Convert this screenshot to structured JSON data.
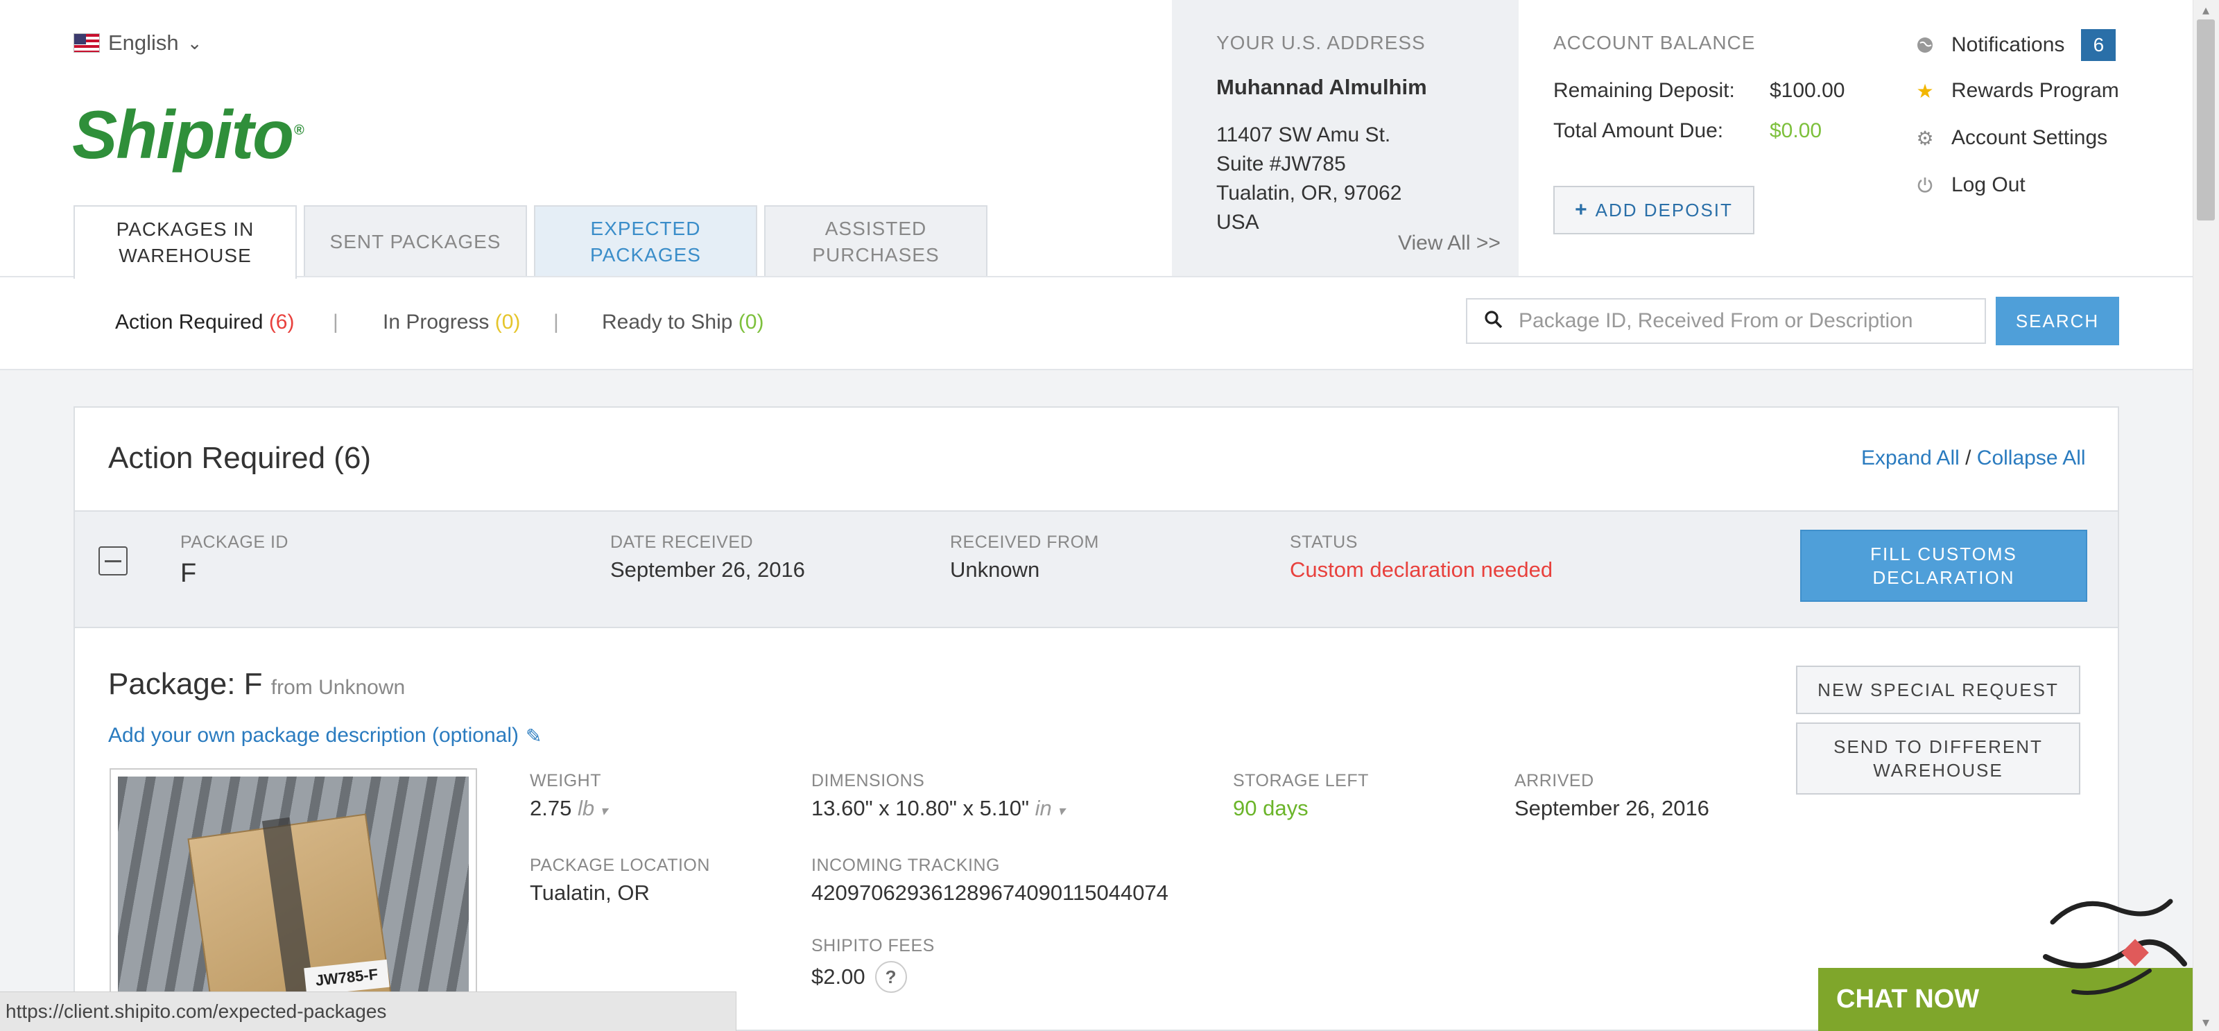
{
  "header": {
    "language": "English",
    "logo": "Shipito",
    "logo_mark": "®"
  },
  "tabs": [
    {
      "label_line1": "PACKAGES IN",
      "label_line2": "WAREHOUSE"
    },
    {
      "label_line1": "SENT PACKAGES",
      "label_line2": ""
    },
    {
      "label_line1": "EXPECTED",
      "label_line2": "PACKAGES"
    },
    {
      "label_line1": "ASSISTED",
      "label_line2": "PURCHASES"
    }
  ],
  "address": {
    "label": "YOUR U.S. ADDRESS",
    "name": "Muhannad Almulhim",
    "street": "11407 SW Amu St.",
    "suite": "Suite #JW785",
    "city": "Tualatin, OR, 97062",
    "country": "USA",
    "view_all": "View All >>"
  },
  "balance": {
    "label": "ACCOUNT BALANCE",
    "remaining_label": "Remaining Deposit:",
    "remaining_value": "$100.00",
    "due_label": "Total Amount Due:",
    "due_value": "$0.00",
    "add_deposit": "ADD DEPOSIT"
  },
  "account_menu": {
    "notifications": "Notifications",
    "notifications_count": "6",
    "rewards": "Rewards Program",
    "settings": "Account Settings",
    "logout": "Log Out"
  },
  "filters": {
    "action_required": "Action Required",
    "action_required_count": "(6)",
    "in_progress": "In Progress",
    "in_progress_count": "(0)",
    "ready_to_ship": "Ready to Ship",
    "ready_to_ship_count": "(0)",
    "separator": "|"
  },
  "search": {
    "placeholder": "Package ID, Received From or Description",
    "button": "SEARCH"
  },
  "section": {
    "title": "Action Required (6)",
    "expand_all": "Expand All",
    "slash": " / ",
    "collapse_all": "Collapse All"
  },
  "package_row": {
    "id_label": "PACKAGE ID",
    "id_value": "F",
    "date_label": "DATE RECEIVED",
    "date_value": "September 26, 2016",
    "from_label": "RECEIVED FROM",
    "from_value": "Unknown",
    "status_label": "STATUS",
    "status_value": "Custom declaration needed",
    "customs_btn_line1": "FILL CUSTOMS",
    "customs_btn_line2": "DECLARATION"
  },
  "package_detail": {
    "title_prefix": "Package: F",
    "title_from": "from Unknown",
    "add_description": "Add your own package description (optional)",
    "weight_label": "WEIGHT",
    "weight_value": "2.75",
    "weight_unit": "lb",
    "dimensions_label": "DIMENSIONS",
    "dimensions_value": "13.60\" x 10.80\" x 5.10\"",
    "dimensions_unit": "in",
    "storage_label": "STORAGE LEFT",
    "storage_value": "90 days",
    "arrived_label": "ARRIVED",
    "arrived_value": "September 26, 2016",
    "location_label": "PACKAGE LOCATION",
    "location_value": "Tualatin, OR",
    "tracking_label": "INCOMING TRACKING",
    "tracking_value": "420970629361289674090115044074",
    "fees_label": "SHIPITO FEES",
    "fees_value": "$2.00",
    "fees_help": "?",
    "photo_label": "JW785-F",
    "new_request": "NEW SPECIAL REQUEST",
    "send_diff_line1": "SEND TO DIFFERENT",
    "send_diff_line2": "WAREHOUSE"
  },
  "statusbar": {
    "url": "https://client.shipito.com/expected-packages"
  },
  "chat": {
    "label": "CHAT NOW"
  },
  "colors": {
    "brand_green": "#2f8f3a",
    "accent_blue": "#4f9fd9",
    "link_blue": "#2a7bbf",
    "error_red": "#e8413d",
    "success_green": "#7dc03c",
    "warning_yellow": "#e5c52b",
    "chat_green": "#7fa62b"
  },
  "icons": {
    "language": "us-flag-icon",
    "chevron": "chevron-down-icon",
    "notifications": "globe-icon",
    "rewards": "star-icon",
    "settings": "gear-icon",
    "logout": "power-icon",
    "search": "search-icon",
    "collapse": "minus-box-icon",
    "edit": "pencil-icon",
    "add": "plus-icon"
  }
}
